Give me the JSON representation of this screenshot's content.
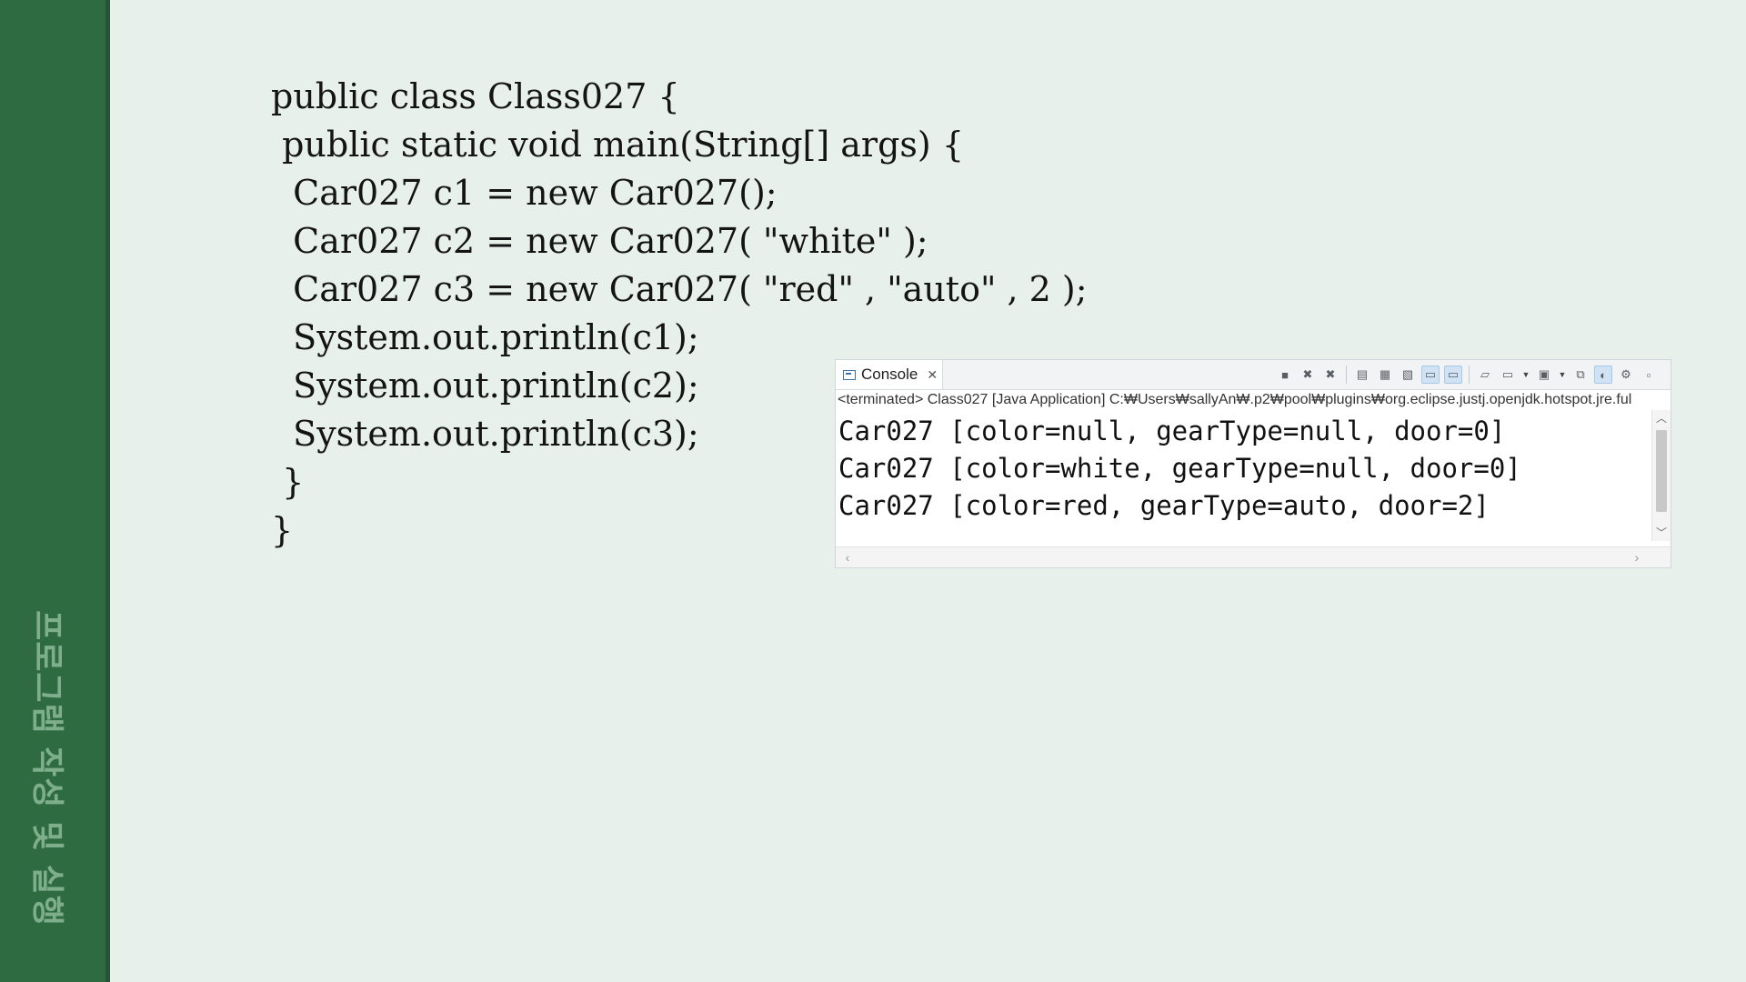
{
  "sidebar": {
    "vertical_title": "프로그램 작성 및 실행"
  },
  "code": {
    "lines": [
      "public class Class027 {",
      " public static void main(String[] args) {",
      "  Car027 c1 = new Car027();",
      "  Car027 c2 = new Car027( \"white\" );",
      "  Car027 c3 = new Car027( \"red\" , \"auto\" , 2 );",
      "  System.out.println(c1);",
      "  System.out.println(c2);",
      "  System.out.println(c3);",
      " }",
      "}"
    ]
  },
  "console": {
    "tab_label": "Console",
    "tab_close": "✕",
    "status_line": "<terminated> Class027 [Java Application] C:₩Users₩sallyAn₩.p2₩pool₩plugins₩org.eclipse.justj.openjdk.hotspot.jre.ful",
    "output_lines": [
      "Car027 [color=null, gearType=null, door=0]",
      "Car027 [color=white, gearType=null, door=0]",
      "Car027 [color=red, gearType=auto, door=2]"
    ],
    "toolbar_icons": [
      "terminate-icon",
      "remove-launch-icon",
      "remove-all-terminated-icon",
      "clear-console-icon",
      "scroll-lock-icon",
      "word-wrap-icon",
      "show-on-stdout-icon",
      "show-on-stderr-icon",
      "pin-console-icon",
      "display-selected-console-icon",
      "open-console-icon",
      "copy-icon",
      "toggle-view-icon",
      "settings-icon",
      "minimize-icon"
    ]
  },
  "colors": {
    "sidebar": "#2f6b40",
    "sidebar_text": "#7fae8c",
    "background": "#e8f0eb",
    "code_text": "#141414"
  }
}
